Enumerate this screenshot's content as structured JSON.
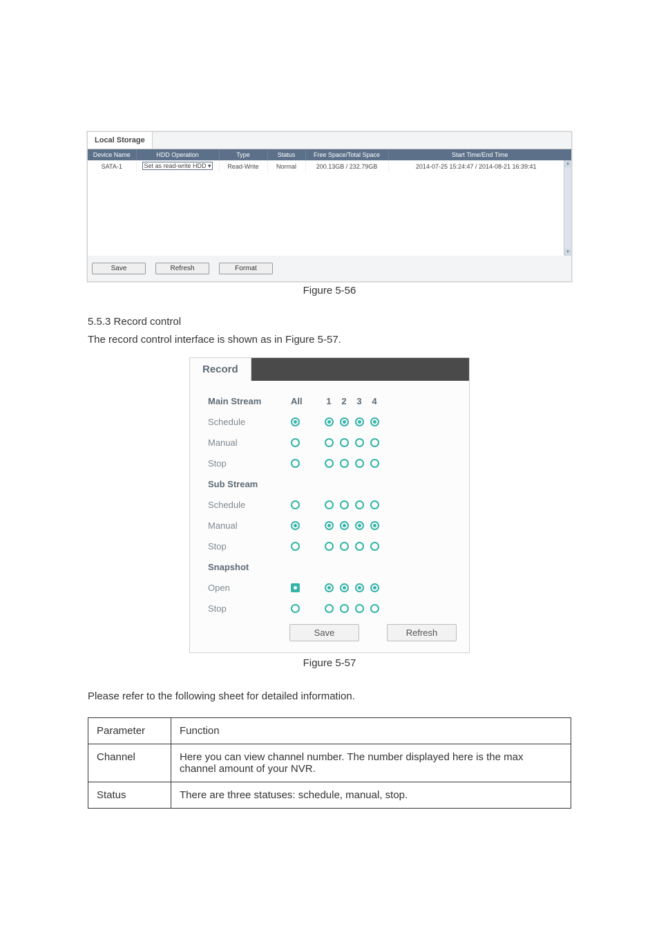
{
  "storage": {
    "tab": "Local Storage",
    "headers": {
      "device": "Device Name",
      "hdd_op": "HDD Operation",
      "type": "Type",
      "status": "Status",
      "space": "Free Space/Total Space",
      "time": "Start Time/End Time"
    },
    "row": {
      "device": "SATA-1",
      "hdd_op_value": "Set as read-write HDD",
      "type": "Read-Write",
      "status": "Normal",
      "space": "200.13GB / 232.79GB",
      "time": "2014-07-25 15:24:47 / 2014-08-21 16:39:41"
    },
    "buttons": {
      "save": "Save",
      "refresh": "Refresh",
      "format": "Format"
    }
  },
  "fig1_caption": "Figure 5-56",
  "sec_heading": "5.5.3 Record control",
  "sec_body": "The record control interface is shown as in Figure 5-57.",
  "record": {
    "tab": "Record",
    "main_stream": "Main Stream",
    "sub_stream": "Sub Stream",
    "snapshot": "Snapshot",
    "labels": {
      "schedule": "Schedule",
      "manual": "Manual",
      "stop": "Stop",
      "open": "Open"
    },
    "cols": {
      "all": "All",
      "c1": "1",
      "c2": "2",
      "c3": "3",
      "c4": "4"
    },
    "buttons": {
      "save": "Save",
      "refresh": "Refresh"
    }
  },
  "fig2_caption": "Figure 5-57",
  "gloss_intro": "Please refer to the following sheet for detailed information.",
  "gloss": {
    "h_param": "Parameter",
    "h_func": "Function",
    "r1p": "Channel",
    "r1f": "Here you can view channel number. The number displayed here is the max channel amount of your NVR.",
    "r2p": "Status",
    "r2f": "There are three statuses: schedule, manual, stop."
  }
}
